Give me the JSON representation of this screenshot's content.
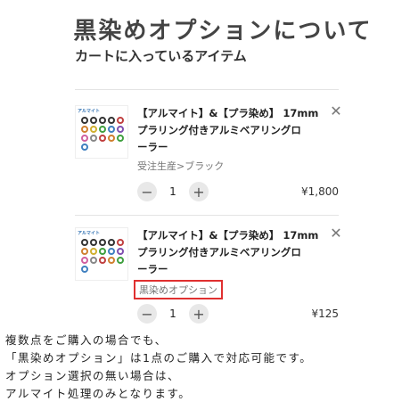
{
  "header": {
    "title": "黒染めオプションについて",
    "subtitle": "カートに入っているアイテム"
  },
  "items": [
    {
      "thumb_label": "アルマイト",
      "name_line1": "【アルマイト】&【プラ染め】 17mm",
      "name_line2": "プラリング付きアルミベアリングロ",
      "name_line3": "ーラー",
      "option": "受注生産>ブラック",
      "quantity": "1",
      "price": "¥1,800",
      "minus": "−",
      "plus": "+",
      "remove": "✕"
    },
    {
      "thumb_label": "アルマイト",
      "name_line1": "【アルマイト】&【プラ染め】 17mm",
      "name_line2": "プラリング付きアルミベアリングロ",
      "name_line3": "ーラー",
      "option": "黒染めオプション",
      "quantity": "1",
      "price": "¥125",
      "minus": "−",
      "plus": "+",
      "remove": "✕"
    }
  ],
  "notes": [
    "複数点をご購入の場合でも、",
    "「黒染めオプション」は1点のご購入で対応可能です。",
    "オプション選択の無い場合は、",
    "アルマイト処理のみとなります。"
  ],
  "colors": {
    "highlight_border": "#e03030",
    "button_bg": "#e8e8e8"
  },
  "thumb_dot_colors": [
    "#333333",
    "#333333",
    "#333333",
    "#333333",
    "#c04040",
    "#d08030",
    "#d0b030",
    "#40a040",
    "#4080c0",
    "#8050b0",
    "#d060a0",
    "#888888",
    "#c04040",
    "#d08030",
    "#40a040",
    "#4080c0"
  ]
}
